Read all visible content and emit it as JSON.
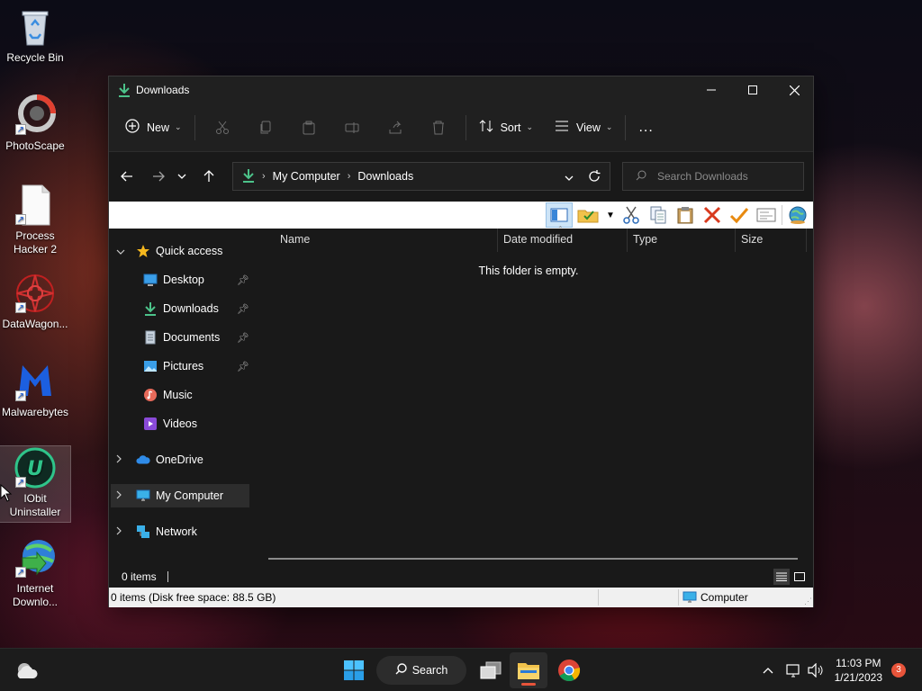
{
  "desktop": {
    "icons": [
      {
        "label": "Recycle Bin"
      },
      {
        "label": "PhotoScape"
      },
      {
        "label": "Process Hacker 2"
      },
      {
        "label": "DataWagon..."
      },
      {
        "label": "Malwarebytes"
      },
      {
        "label": "IObit Uninstaller"
      },
      {
        "label": "Internet Downlo..."
      }
    ]
  },
  "window": {
    "title": "Downloads",
    "toolbar": {
      "new_label": "New",
      "sort_label": "Sort",
      "view_label": "View",
      "more_label": "..."
    },
    "address": {
      "crumb1": "My Computer",
      "crumb2": "Downloads"
    },
    "search": {
      "placeholder": "Search Downloads"
    },
    "nav": {
      "quick_access": "Quick access",
      "items": [
        {
          "label": "Desktop"
        },
        {
          "label": "Downloads"
        },
        {
          "label": "Documents"
        },
        {
          "label": "Pictures"
        },
        {
          "label": "Music"
        },
        {
          "label": "Videos"
        }
      ],
      "onedrive": "OneDrive",
      "my_computer": "My Computer",
      "network": "Network"
    },
    "columns": {
      "name": "Name",
      "date": "Date modified",
      "type": "Type",
      "size": "Size"
    },
    "empty_text": "This folder is empty.",
    "status_dark": "0 items",
    "status_white_left": "0 items (Disk free space: 88.5 GB)",
    "status_white_right": "Computer"
  },
  "taskbar": {
    "search_label": "Search",
    "time": "11:03 PM",
    "date": "1/21/2023",
    "notification_count": "3"
  },
  "colors": {
    "accent": "#4cc2ff",
    "folder_green": "#4cc38a",
    "badge": "#e8543a"
  }
}
